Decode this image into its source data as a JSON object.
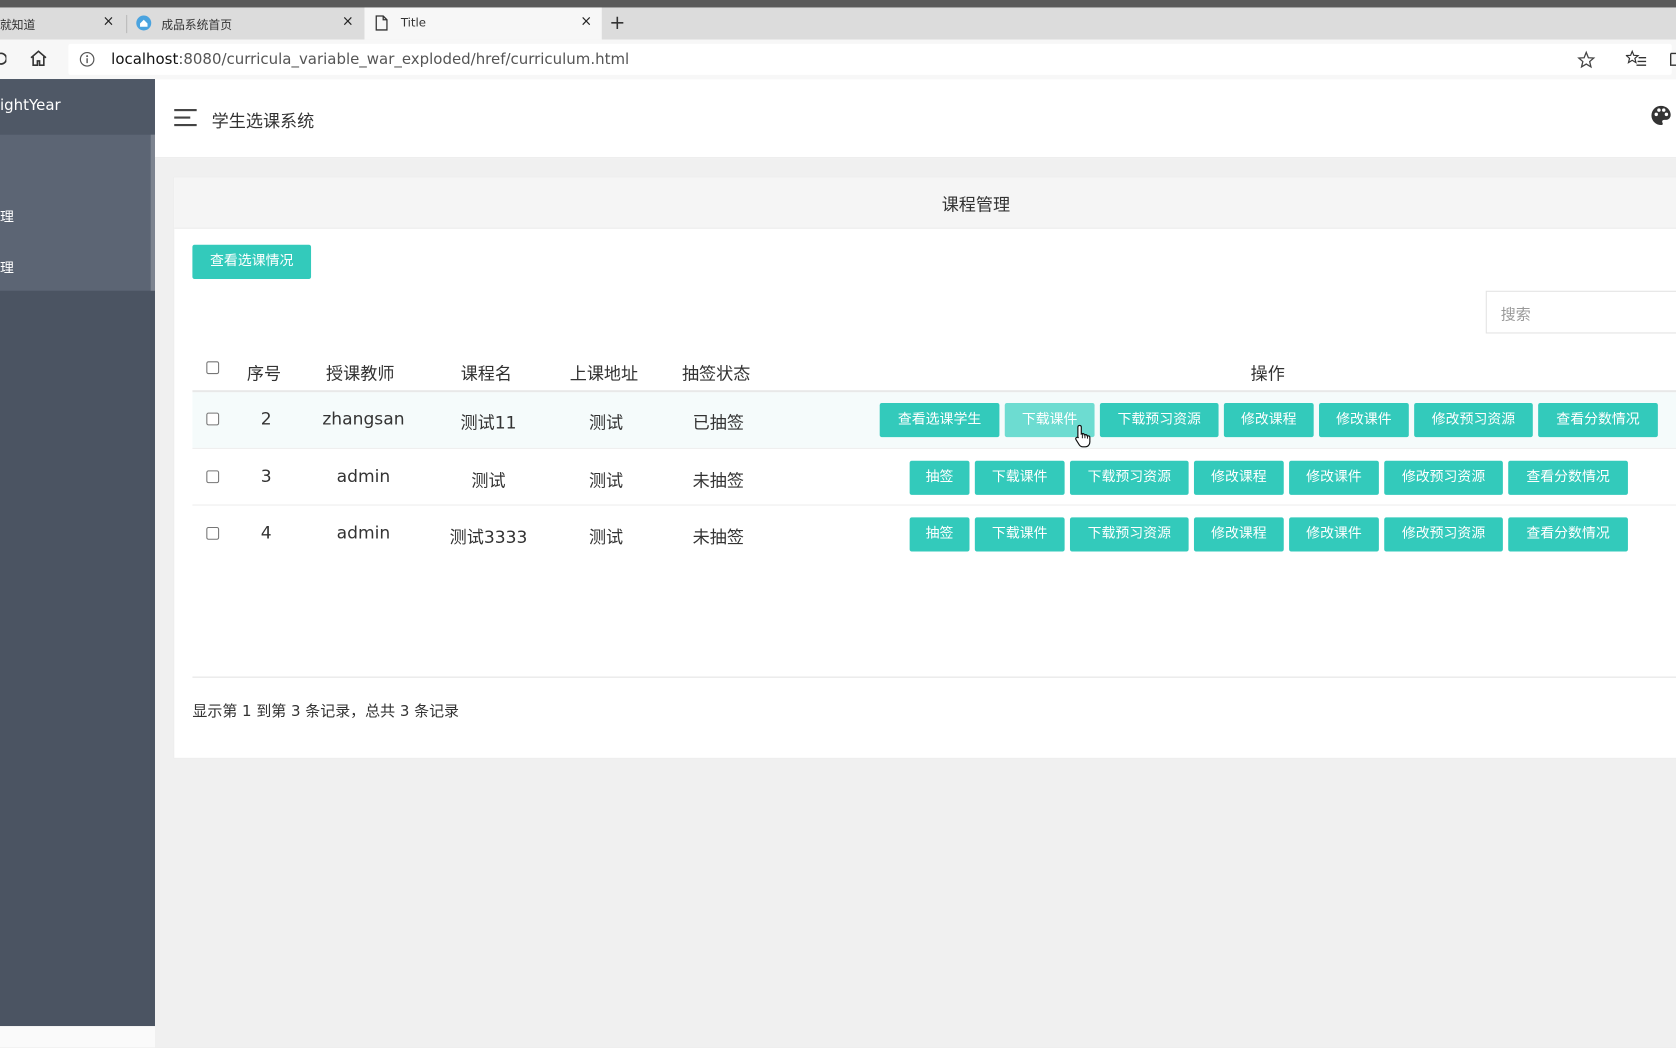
{
  "browser": {
    "tabs": [
      {
        "title": "就知道",
        "close": "×"
      },
      {
        "title": "成品系统首页",
        "close": "×"
      },
      {
        "title": "Title",
        "close": "×"
      }
    ],
    "new_tab": "+",
    "url_host": "localhost",
    "url_rest": ":8080/curricula_variable_war_exploded/href/curriculum.html"
  },
  "sidebar": {
    "brand": "ightYear",
    "items": [
      "理",
      "理"
    ]
  },
  "header": {
    "title": "学生选课系统"
  },
  "card": {
    "title": "课程管理",
    "view_selection_button": "查看选课情况",
    "search_placeholder": "搜索"
  },
  "table": {
    "columns": [
      "序号",
      "授课教师",
      "课程名",
      "上课地址",
      "抽签状态",
      "操作"
    ],
    "rows": [
      {
        "id": "2",
        "teacher": "zhangsan",
        "course": "测试11",
        "location": "测试",
        "status": "已抽签",
        "actions": [
          "查看选课学生",
          "下载课件",
          "下载预习资源",
          "修改课程",
          "修改课件",
          "修改预习资源",
          "查看分数情况"
        ]
      },
      {
        "id": "3",
        "teacher": "admin",
        "course": "测试",
        "location": "测试",
        "status": "未抽签",
        "actions": [
          "抽签",
          "下载课件",
          "下载预习资源",
          "修改课程",
          "修改课件",
          "修改预习资源",
          "查看分数情况"
        ]
      },
      {
        "id": "4",
        "teacher": "admin",
        "course": "测试3333",
        "location": "测试",
        "status": "未抽签",
        "actions": [
          "抽签",
          "下载课件",
          "下载预习资源",
          "修改课程",
          "修改课件",
          "修改预习资源",
          "查看分数情况"
        ]
      }
    ],
    "footer": "显示第 1 到第 3 条记录，总共 3 条记录"
  },
  "colors": {
    "accent": "#33cabb",
    "accent_hover": "#6ddcd1",
    "sidebar_bg": "#4b5462",
    "sidebar_active": "#5c6574"
  },
  "icons": [
    "back-icon",
    "home-icon",
    "info-icon",
    "star-icon",
    "favorites-icon",
    "page-icon",
    "menu-icon",
    "palette-icon"
  ]
}
